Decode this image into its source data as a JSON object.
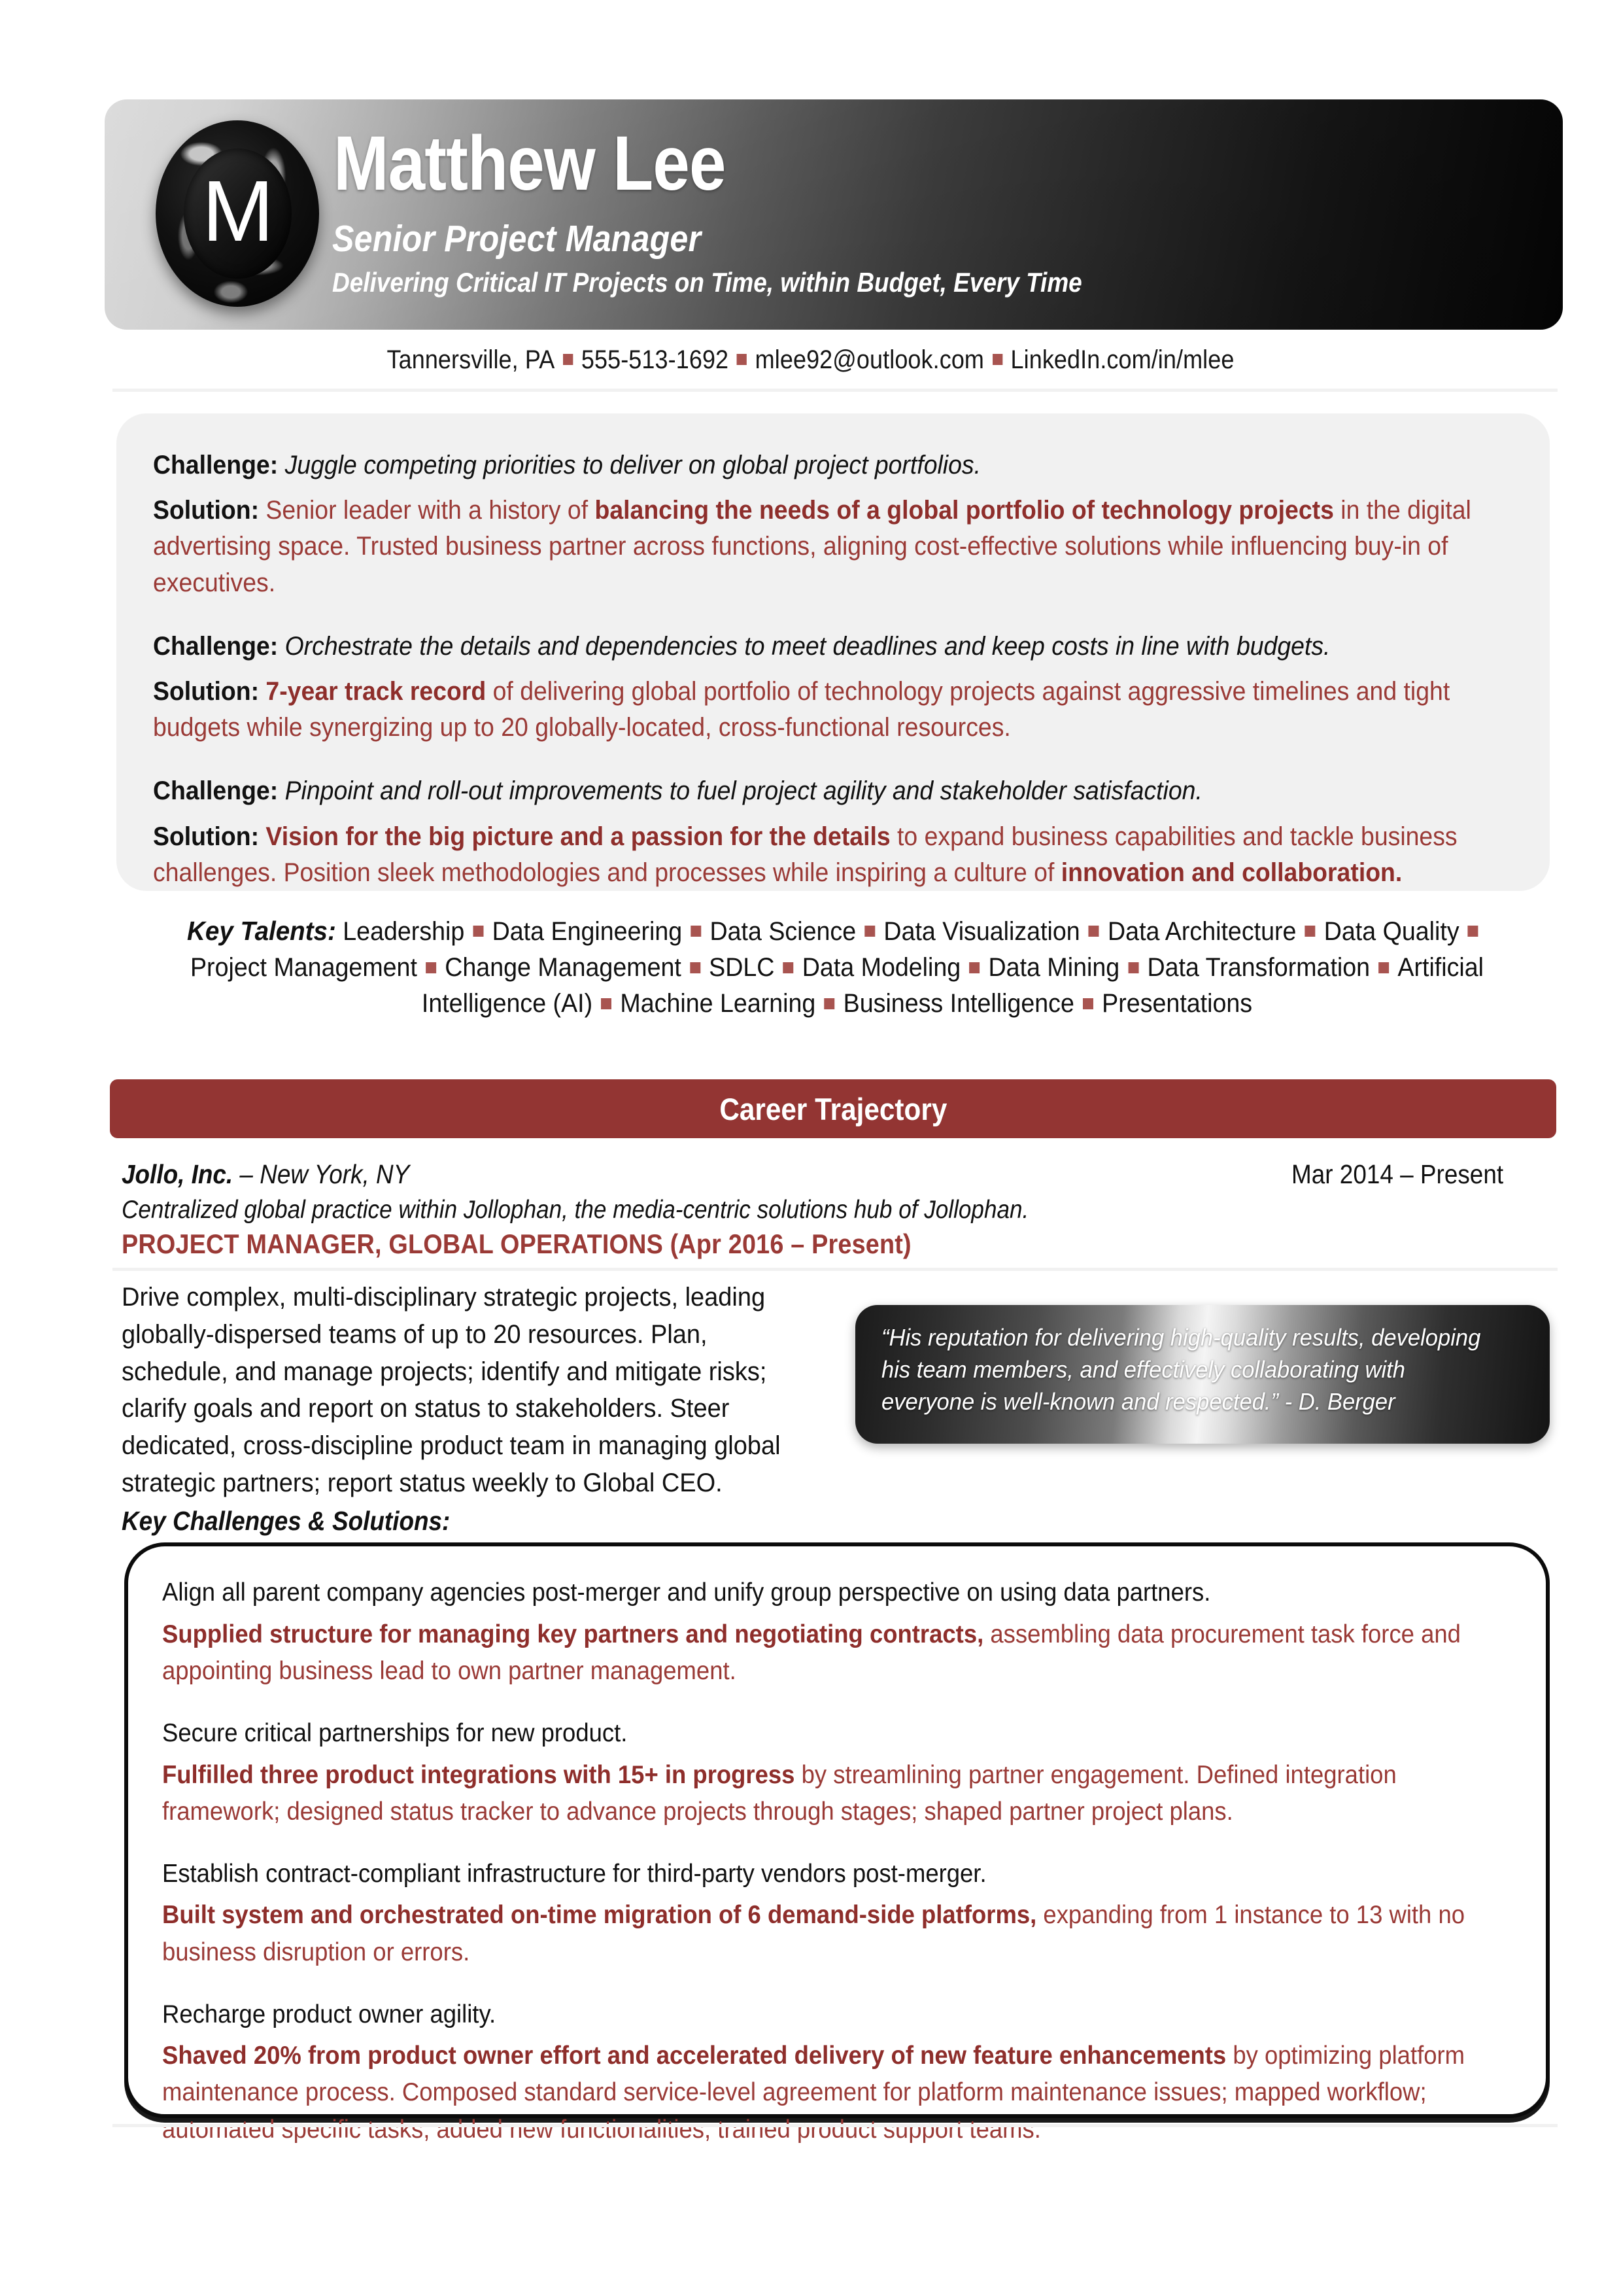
{
  "header": {
    "logo_letter": "M",
    "name": "Matthew Lee",
    "role": "Senior Project Manager",
    "tagline": "Delivering Critical IT Projects on Time, within Budget, Every Time"
  },
  "contact": {
    "location": "Tannersville, PA",
    "phone": "555-513-1692",
    "email": "mlee92@outlook.com",
    "linkedin": "LinkedIn.com/in/mlee"
  },
  "summary": {
    "challenge_label": "Challenge:",
    "solution_label": "Solution:",
    "items": [
      {
        "challenge": "Juggle competing priorities to deliver on global project portfolios.",
        "solution_pre": "Senior leader with a history of ",
        "solution_bold": "balancing the needs of a global portfolio of technology projects",
        "solution_post": " in the digital advertising space. Trusted business partner across functions, aligning cost-effective solutions while influencing buy-in of executives."
      },
      {
        "challenge": "Orchestrate the details and dependencies to meet deadlines and keep costs in line with budgets.",
        "solution_pre": "",
        "solution_bold": "7-year track record",
        "solution_post": " of delivering global portfolio of technology projects against aggressive timelines and tight budgets while synergizing up to 20 globally-located, cross-functional resources."
      },
      {
        "challenge": "Pinpoint and roll-out improvements to fuel project agility and stakeholder satisfaction.",
        "solution_pre": "",
        "solution_bold": "Vision for the big picture and a passion for the details",
        "solution_post": " to expand business capabilities and tackle business challenges. Position sleek methodologies and processes while inspiring a culture of ",
        "solution_bold2": "innovation and collaboration."
      }
    ]
  },
  "key_talents": {
    "label": "Key Talents:",
    "items": [
      "Leadership",
      "Data Engineering",
      "Data Science",
      "Data Visualization",
      "Data Architecture",
      "Data Quality",
      "Project Management",
      "Change Management",
      "SDLC",
      "Data Modeling",
      "Data Mining",
      "Data Transformation",
      "Artificial Intelligence (AI)",
      "Machine Learning",
      "Business Intelligence",
      "Presentations"
    ]
  },
  "career_section": {
    "title": "Career Trajectory",
    "job": {
      "company": "Jollo, Inc.",
      "location": " – New York, NY",
      "dates": "Mar 2014 – Present",
      "subtitle": "Centralized global practice within Jollophan, the media-centric solutions hub of Jollophan.",
      "title": "PROJECT MANAGER, GLOBAL OPERATIONS (Apr 2016 – Present)",
      "description": "Drive complex, multi-disciplinary strategic projects, leading globally-dispersed teams of up to 20 resources. Plan, schedule, and manage projects; identify and mitigate risks; clarify goals and report on status to stakeholders. Steer dedicated, cross-discipline product team in managing global strategic partners; report status weekly to Global CEO.",
      "quote": "“His reputation for delivering high-quality results, developing his team members, and effectively collaborating with everyone is well-known and respected.” - D. Berger",
      "kcs_label": "Key Challenges & Solutions:",
      "key_challenges": [
        {
          "challenge": "Align all parent company agencies post-merger and unify group perspective on using data partners.",
          "solution_bold": "Supplied structure for managing key partners and negotiating contracts,",
          "solution_rest": " assembling data procurement task force and appointing business lead to own partner management."
        },
        {
          "challenge": "Secure critical partnerships for new product.",
          "solution_bold": "Fulfilled three product integrations with 15+ in progress",
          "solution_rest": " by streamlining partner engagement. Defined integration framework; designed status tracker to advance projects through stages; shaped partner project plans."
        },
        {
          "challenge": "Establish contract-compliant infrastructure for third-party vendors post-merger.",
          "solution_bold": "Built system and orchestrated on-time migration of 6 demand-side platforms,",
          "solution_rest": " expanding from 1 instance to 13 with no business disruption or errors."
        },
        {
          "challenge": "Recharge product owner agility.",
          "solution_bold": "Shaved 20% from product owner effort and accelerated delivery of new feature enhancements",
          "solution_rest": " by optimizing platform maintenance process. Composed standard service-level agreement for platform maintenance issues; mapped workflow; automated specific tasks; added new functionalities; trained product support teams."
        }
      ]
    }
  },
  "colors": {
    "accent_bar": "#933533",
    "accent_text": "#9a3a36",
    "accent_bold": "#8e2e2b",
    "bullet": "#a85450",
    "summary_bg": "#f1f1f1",
    "rule": "#f1f1f1"
  }
}
